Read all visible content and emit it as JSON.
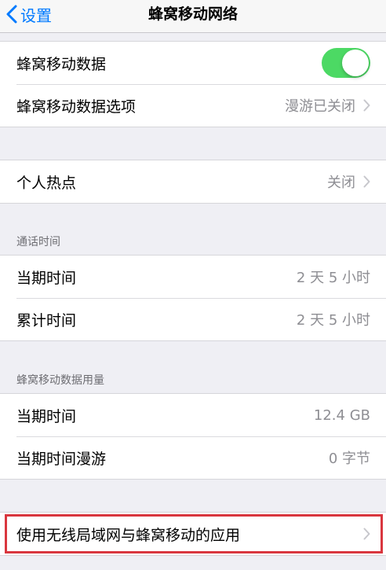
{
  "nav": {
    "back_label": "设置",
    "title": "蜂窝移动网络"
  },
  "cellular": {
    "data_label": "蜂窝移动数据",
    "data_enabled": true,
    "options_label": "蜂窝移动数据选项",
    "options_value": "漫游已关闭"
  },
  "hotspot": {
    "label": "个人热点",
    "value": "关闭"
  },
  "call_time": {
    "header": "通话时间",
    "current_label": "当期时间",
    "current_value": "2 天 5 小时",
    "lifetime_label": "累计时间",
    "lifetime_value": "2 天 5 小时"
  },
  "data_usage": {
    "header": "蜂窝移动数据用量",
    "current_label": "当期时间",
    "current_value": "12.4 GB",
    "roaming_label": "当期时间漫游",
    "roaming_value": "0 字节"
  },
  "wlan_assist": {
    "label": "使用无线局域网与蜂窝移动的应用"
  },
  "colors": {
    "accent": "#007aff",
    "toggle_on": "#4cd964",
    "highlight": "#d9363e",
    "background": "#efeff4"
  }
}
